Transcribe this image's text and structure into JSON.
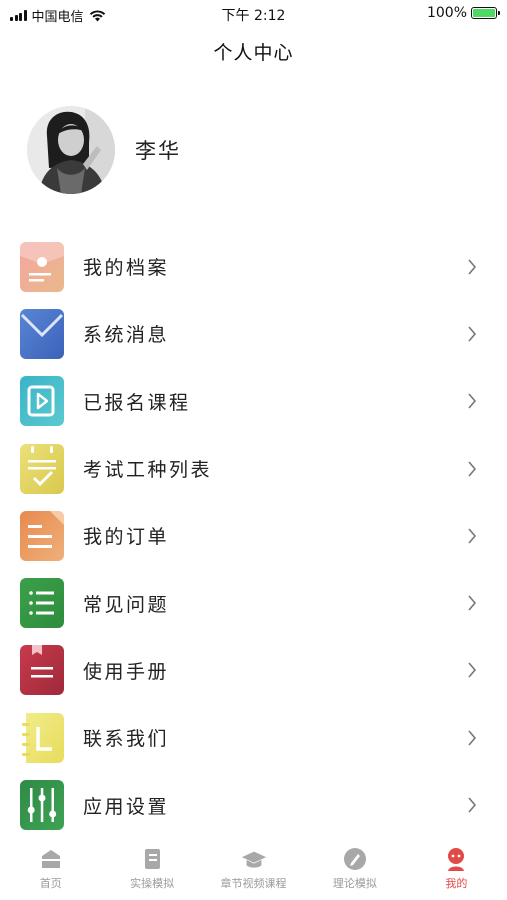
{
  "status_bar": {
    "carrier": "中国电信",
    "time": "下午 2:12",
    "battery": "100%"
  },
  "nav": {
    "title": "个人中心"
  },
  "profile": {
    "name": "李华"
  },
  "menu": [
    {
      "label": "我的档案",
      "icon": "profile-folder-icon"
    },
    {
      "label": "系统消息",
      "icon": "envelope-icon"
    },
    {
      "label": "已报名课程",
      "icon": "video-course-icon"
    },
    {
      "label": "考试工种列表",
      "icon": "checklist-icon"
    },
    {
      "label": "我的订单",
      "icon": "order-document-icon"
    },
    {
      "label": "常见问题",
      "icon": "list-icon"
    },
    {
      "label": "使用手册",
      "icon": "manual-book-icon"
    },
    {
      "label": "联系我们",
      "icon": "contact-notebook-icon"
    },
    {
      "label": "应用设置",
      "icon": "sliders-icon"
    }
  ],
  "tabbar": [
    {
      "label": "首页",
      "active": false
    },
    {
      "label": "实操模拟",
      "active": false
    },
    {
      "label": "章节视频课程",
      "active": false
    },
    {
      "label": "理论模拟",
      "active": false
    },
    {
      "label": "我的",
      "active": true
    }
  ],
  "colors": {
    "accent": "#e14a47",
    "tab_inactive": "#9a9a9a"
  }
}
